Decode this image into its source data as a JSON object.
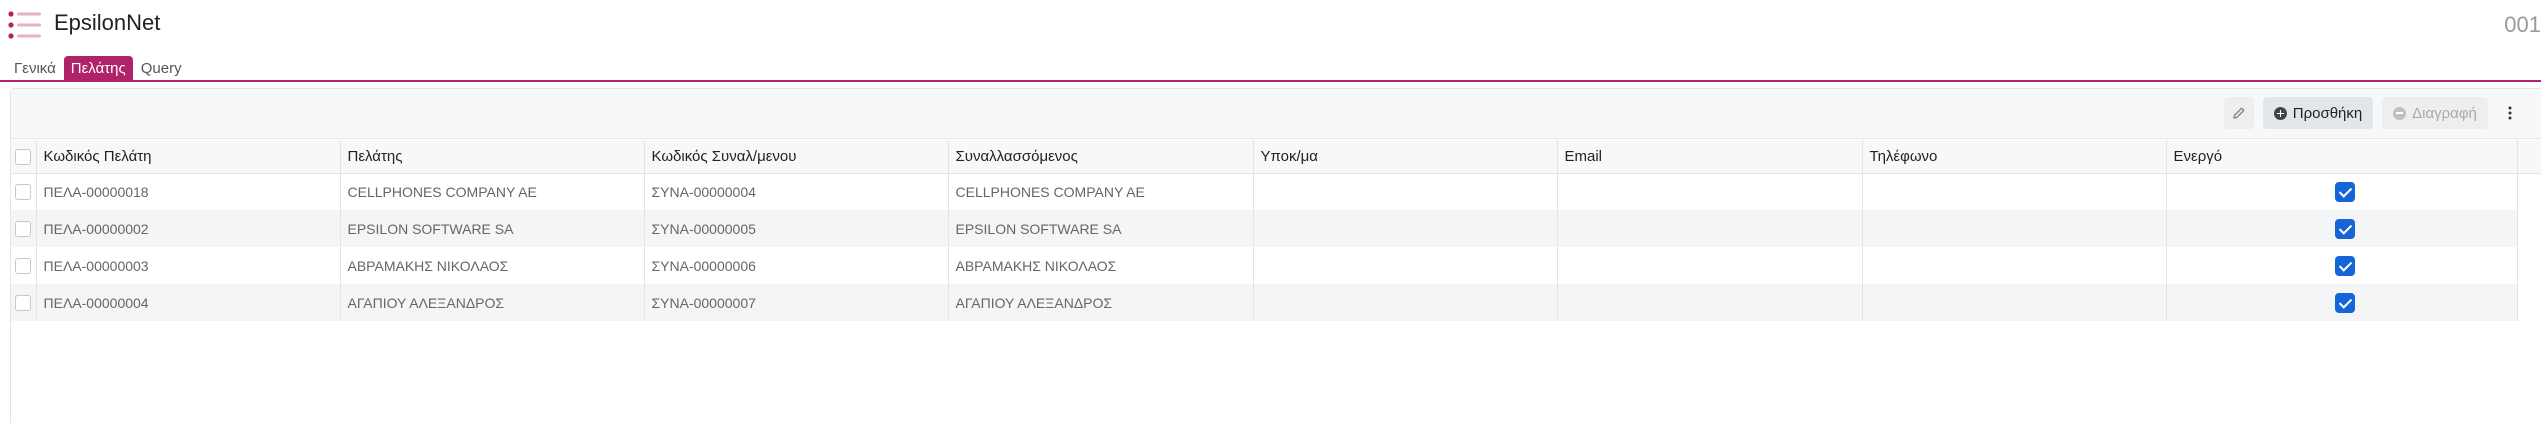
{
  "header": {
    "app_title": "EpsilonNet",
    "code": "001",
    "menu_icon": "hamburger-list-icon"
  },
  "tabs": [
    {
      "label": "Γενικά",
      "active": false
    },
    {
      "label": "Πελάτης",
      "active": true
    },
    {
      "label": "Query",
      "active": false
    }
  ],
  "toolbar": {
    "edit_icon": "pencil-icon",
    "add_label": "Προσθήκη",
    "delete_label": "Διαγραφή",
    "more_icon": "vertical-dots-icon"
  },
  "colors": {
    "accent": "#b0226a",
    "checkbox": "#1565d8"
  },
  "table": {
    "columns": [
      "Κωδικός Πελάτη",
      "Πελάτης",
      "Κωδικός Συναλ/μενου",
      "Συναλλασσόμενος",
      "Υποκ/μα",
      "Email",
      "Τηλέφωνο",
      "Ενεργό"
    ],
    "rows": [
      {
        "code": "ΠΕΛΑ-00000018",
        "customer": "CELLPHONES COMPANY AE",
        "trader_code": "ΣΥΝΑ-00000004",
        "trader": "CELLPHONES COMPANY AE",
        "branch": "",
        "email": "",
        "phone": "",
        "active": true
      },
      {
        "code": "ΠΕΛΑ-00000002",
        "customer": "EPSILON SOFTWARE SA",
        "trader_code": "ΣΥΝΑ-00000005",
        "trader": "EPSILON SOFTWARE SA",
        "branch": "",
        "email": "",
        "phone": "",
        "active": true
      },
      {
        "code": "ΠΕΛΑ-00000003",
        "customer": "ΑΒΡΑΜΑΚΗΣ ΝΙΚΟΛΑΟΣ",
        "trader_code": "ΣΥΝΑ-00000006",
        "trader": "ΑΒΡΑΜΑΚΗΣ ΝΙΚΟΛΑΟΣ",
        "branch": "",
        "email": "",
        "phone": "",
        "active": true
      },
      {
        "code": "ΠΕΛΑ-00000004",
        "customer": "ΑΓΑΠΙΟΥ ΑΛΕΞΑΝΔΡΟΣ",
        "trader_code": "ΣΥΝΑ-00000007",
        "trader": "ΑΓΑΠΙΟΥ ΑΛΕΞΑΝΔΡΟΣ",
        "branch": "",
        "email": "",
        "phone": "",
        "active": true
      }
    ]
  }
}
